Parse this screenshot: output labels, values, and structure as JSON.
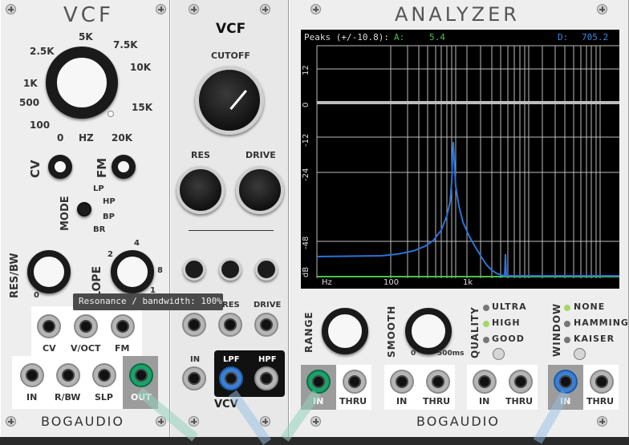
{
  "left_vcf": {
    "title": "VCF",
    "freq_labels": [
      "5K",
      "7.5K",
      "2.5K",
      "10K",
      "1K",
      "500",
      "15K",
      "100",
      "20K",
      "0",
      "HZ"
    ],
    "cv_label": "CV",
    "fm_label": "FM",
    "mode_label": "MODE",
    "mode_options": [
      "LP",
      "HP",
      "BP",
      "BR"
    ],
    "resbw_label": "RES/BW",
    "slope_label": "SLOPE",
    "resbw_zero": "0",
    "slope_ticks": [
      "4",
      "2",
      "8",
      "1"
    ],
    "jacks_top": [
      "CV",
      "V/OCT",
      "FM"
    ],
    "jacks_bottom": [
      "IN",
      "R/BW",
      "SLP",
      "OUT"
    ],
    "brand": "BOGAUDIO"
  },
  "tooltip": "Resonance / bandwidth: 100%",
  "vcv_vcf": {
    "title": "VCF",
    "cutoff_label": "CUTOFF",
    "res_label": "RES",
    "drive_label": "DRIVE",
    "cv_row_labels": [
      "RES",
      "DRIVE"
    ],
    "in_label": "IN",
    "lpf_label": "LPF",
    "hpf_label": "HPF",
    "brand": "VCV"
  },
  "analyzer": {
    "title": "ANALYZER",
    "peaks_label": "Peaks (+/-10.8):",
    "a_label": "A:",
    "a_value": "5.4",
    "d_label": "D:",
    "d_value": "705.2",
    "db_ticks": [
      "12",
      "0",
      "-12",
      "-24",
      "-48",
      "dB"
    ],
    "freq_ticks": [
      "Hz",
      "100",
      "1k"
    ],
    "range_label": "RANGE",
    "smooth_label": "SMOOTH",
    "smooth_min": "0",
    "smooth_max": "500ms",
    "quality_label": "QUALITY",
    "quality_options": [
      "ULTRA",
      "HIGH",
      "GOOD"
    ],
    "quality_selected": "HIGH",
    "window_label": "WINDOW",
    "window_options": [
      "NONE",
      "HAMMING",
      "KAISER"
    ],
    "window_selected": "NONE",
    "jack_in": "IN",
    "jack_thru": "THRU",
    "brand": "BOGAUDIO",
    "colors": {
      "trace": "#2a73d6",
      "green": "#49c24b",
      "a_value": "#49c24b",
      "d_value": "#3a88e6",
      "screen": "#000000",
      "grid": "#bdbdbd"
    }
  }
}
